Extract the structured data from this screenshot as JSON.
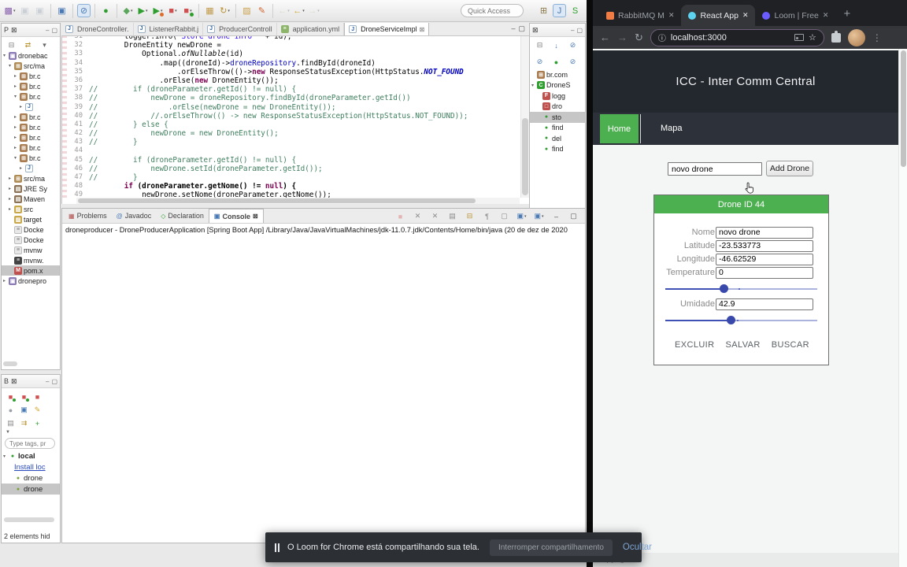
{
  "colors": {
    "accent_green": "#4caf50",
    "slider_blue": "#3f51b5",
    "page_header_bg": "#23272e",
    "nav_bg": "#2d323a",
    "chrome_dark": "#202124",
    "chrome_toolbar": "#35363a"
  },
  "eclipse": {
    "main_toolbar": {
      "quick_access_placeholder": "Quick Access",
      "icons": [
        {
          "name": "new-wizard-icon",
          "glyph": "▩",
          "color": "#8a62ad",
          "dd": true
        },
        {
          "name": "save-icon",
          "glyph": "▣",
          "color": "#8899aa",
          "disabled": true
        },
        {
          "name": "save-all-icon",
          "glyph": "▣",
          "color": "#8899aa",
          "disabled": true
        },
        {
          "sep": true
        },
        {
          "name": "console-view-icon",
          "glyph": "▣",
          "color": "#4a7ab5"
        },
        {
          "sep": true
        },
        {
          "name": "skip-breakpoints-icon",
          "glyph": "⊘",
          "color": "#4a7ab5",
          "pressed": true
        },
        {
          "sep": true
        },
        {
          "name": "boot-devtools-icon",
          "glyph": "●",
          "color": "#2f9e2f"
        },
        {
          "sep": true
        },
        {
          "name": "debug-icon",
          "glyph": "◆",
          "color": "#5aa65a",
          "dd": true
        },
        {
          "name": "run-icon",
          "glyph": "▶",
          "color": "#2f9e2f",
          "dd": true
        },
        {
          "name": "profile-icon",
          "glyph": "▶",
          "color": "#2f9e2f",
          "badge": "#e06c2c",
          "dd": true
        },
        {
          "name": "stop-icon",
          "glyph": "■",
          "color": "#d14f4f",
          "dd": true
        },
        {
          "name": "relaunch-icon",
          "glyph": "■",
          "color": "#d14f4f",
          "badge": "#2f9e2f",
          "dd": true
        },
        {
          "sep": true
        },
        {
          "name": "table-icon",
          "glyph": "▦",
          "color": "#c09a4a"
        },
        {
          "name": "update-project-icon",
          "glyph": "↻",
          "color": "#b8902c",
          "dd": true
        },
        {
          "sep": true
        },
        {
          "name": "open-resource-icon",
          "glyph": "▨",
          "color": "#caa24e"
        },
        {
          "name": "external-tools-icon",
          "glyph": "✎",
          "color": "#d1622c"
        },
        {
          "sep": true
        },
        {
          "name": "back-history-icon",
          "glyph": "←",
          "color": "#c0b090",
          "disabled": true,
          "dd": true
        },
        {
          "name": "back-icon",
          "glyph": "←",
          "color": "#d1a52c",
          "dd": true
        },
        {
          "name": "forward-icon",
          "glyph": "→",
          "color": "#c0b090",
          "disabled": true,
          "dd": true
        }
      ],
      "right_icons": [
        {
          "name": "open-perspective-icon",
          "glyph": "⊞",
          "color": "#8a7a4a"
        },
        {
          "name": "java-perspective-icon",
          "glyph": "J",
          "color": "#4a7ab5",
          "pressed": true
        },
        {
          "name": "spring-perspective-icon",
          "glyph": "S",
          "color": "#2f9e2f"
        }
      ]
    },
    "package_explorer": {
      "tab_label": "P",
      "tool_icons": [
        {
          "name": "collapse-all-icon",
          "glyph": "⊟",
          "color": "#777"
        },
        {
          "name": "link-editor-icon",
          "glyph": "⇄",
          "color": "#b8902c"
        },
        {
          "name": "view-menu-icon",
          "glyph": "▾",
          "color": "#666"
        }
      ],
      "items": [
        {
          "icon": "project-icon",
          "label": "dronebac",
          "exp": "open",
          "depth": 0
        },
        {
          "icon": "source-folder-icon",
          "label": "src/ma",
          "exp": "open",
          "depth": 1
        },
        {
          "icon": "package-icon",
          "label": "br.c",
          "exp": "closed",
          "depth": 2
        },
        {
          "icon": "package-icon",
          "label": "br.c",
          "exp": "closed",
          "depth": 2
        },
        {
          "icon": "package-icon",
          "label": "br.c",
          "exp": "open",
          "depth": 2
        },
        {
          "icon": "java-file-icon",
          "label": "",
          "exp": "closed",
          "depth": 3
        },
        {
          "icon": "package-icon",
          "label": "br.c",
          "exp": "closed",
          "depth": 2
        },
        {
          "icon": "package-icon",
          "label": "br.c",
          "exp": "closed",
          "depth": 2
        },
        {
          "icon": "package-icon",
          "label": "br.c",
          "exp": "closed",
          "depth": 2
        },
        {
          "icon": "package-icon",
          "label": "br.c",
          "exp": "closed",
          "depth": 2
        },
        {
          "icon": "package-icon",
          "label": "br.c",
          "exp": "open",
          "depth": 2
        },
        {
          "icon": "java-file-icon",
          "label": "",
          "exp": "closed",
          "depth": 3
        },
        {
          "icon": "source-folder-icon",
          "label": "src/ma",
          "exp": "closed",
          "depth": 1
        },
        {
          "icon": "library-icon",
          "label": "JRE Sy",
          "exp": "closed",
          "depth": 1
        },
        {
          "icon": "library-icon",
          "label": "Maven",
          "exp": "closed",
          "depth": 1
        },
        {
          "icon": "folder-icon",
          "label": "src",
          "exp": "closed",
          "depth": 1
        },
        {
          "icon": "folder-icon",
          "label": "target",
          "exp": null,
          "depth": 1
        },
        {
          "icon": "file-icon",
          "label": "Docke",
          "exp": null,
          "depth": 1
        },
        {
          "icon": "file-icon",
          "label": "Docke",
          "exp": null,
          "depth": 1
        },
        {
          "icon": "file-icon",
          "label": "mvnw",
          "exp": null,
          "depth": 1
        },
        {
          "icon": "dark-file-icon",
          "label": "mvnw.",
          "exp": null,
          "depth": 1
        },
        {
          "icon": "pom-icon",
          "label": "pom.x",
          "exp": null,
          "depth": 1,
          "selected": true
        },
        {
          "icon": "project-icon",
          "label": "dronepro",
          "exp": "closed",
          "depth": 0
        }
      ]
    },
    "editor": {
      "tabs": [
        {
          "icon": "java-file-icon",
          "label": "DroneController."
        },
        {
          "icon": "java-file-icon",
          "label": "ListenerRabbit.j"
        },
        {
          "icon": "java-file-icon",
          "label": "ProducerControll"
        },
        {
          "icon": "yaml-file-icon",
          "label": "application.yml"
        },
        {
          "icon": "java-file-icon",
          "label": "DroneServiceImpl",
          "active": true
        }
      ],
      "code_lines": [
        {
          "n": 31,
          "seg": [
            [
              "d",
              "        logger.info("
            ],
            [
              "str",
              "\"Store drone info \""
            ],
            [
              "d",
              " + id);"
            ]
          ]
        },
        {
          "n": 32,
          "seg": [
            [
              "d",
              "        DroneEntity newDrone ="
            ]
          ]
        },
        {
          "n": 33,
          "seg": [
            [
              "d",
              "            Optional."
            ],
            [
              "it",
              "ofNullable"
            ],
            [
              "d",
              "(id)"
            ]
          ]
        },
        {
          "n": 34,
          "seg": [
            [
              "d",
              "                .map((droneId)->"
            ],
            [
              "f",
              "droneRepository"
            ],
            [
              "d",
              ".findById(droneId)"
            ]
          ]
        },
        {
          "n": 35,
          "seg": [
            [
              "d",
              "                    .orElseThrow(()->"
            ],
            [
              "k",
              "new"
            ],
            [
              "d",
              " ResponseStatusException(HttpStatus."
            ],
            [
              "st",
              "NOT_FOUND"
            ]
          ]
        },
        {
          "n": 36,
          "seg": [
            [
              "d",
              "                .orElse("
            ],
            [
              "k",
              "new"
            ],
            [
              "d",
              " DroneEntity());"
            ]
          ]
        },
        {
          "n": 37,
          "seg": [
            [
              "c",
              "//        if (droneParameter.getId() != null) {"
            ]
          ]
        },
        {
          "n": 38,
          "seg": [
            [
              "c",
              "//            newDrone = droneRepository.findById(droneParameter.getId())"
            ]
          ]
        },
        {
          "n": 39,
          "seg": [
            [
              "c",
              "//                .orElse(newDrone = new DroneEntity());"
            ]
          ]
        },
        {
          "n": 40,
          "seg": [
            [
              "c",
              "//            //.orElseThrow(() -> new ResponseStatusException(HttpStatus.NOT_FOUND));"
            ]
          ]
        },
        {
          "n": 41,
          "seg": [
            [
              "c",
              "//        } else {"
            ]
          ]
        },
        {
          "n": 42,
          "seg": [
            [
              "c",
              "//            newDrone = new DroneEntity();"
            ]
          ]
        },
        {
          "n": 43,
          "seg": [
            [
              "c",
              "//        }"
            ]
          ]
        },
        {
          "n": 44,
          "seg": []
        },
        {
          "n": 45,
          "seg": [
            [
              "c",
              "//        if (droneParameter.getId() != null) {"
            ]
          ]
        },
        {
          "n": 46,
          "seg": [
            [
              "c",
              "//            newDrone.setId(droneParameter.getId());"
            ]
          ]
        },
        {
          "n": 47,
          "seg": [
            [
              "c",
              "//        }"
            ]
          ]
        },
        {
          "n": 48,
          "bold": true,
          "seg": [
            [
              "d",
              "        "
            ],
            [
              "k",
              "if"
            ],
            [
              "d",
              " (droneParameter.getNome() != "
            ],
            [
              "k",
              "null"
            ],
            [
              "d",
              ") {"
            ]
          ]
        },
        {
          "n": 49,
          "seg": [
            [
              "d",
              "            newDrone.setNome(droneParameter.getNome());"
            ]
          ]
        }
      ]
    },
    "outline": {
      "tool_icons": [
        {
          "name": "collapse-all-icon",
          "glyph": "⊟",
          "color": "#777"
        },
        {
          "name": "sort-icon",
          "glyph": "↓",
          "color": "#4a7ab5"
        },
        {
          "name": "hide-fields-icon",
          "glyph": "⊘",
          "color": "#4a7ab5"
        },
        {
          "name": "hide-static-icon",
          "glyph": "⊘",
          "color": "#4a7ab5"
        },
        {
          "name": "hide-nonpublic-icon",
          "glyph": "●",
          "color": "#2f9e2f"
        },
        {
          "name": "hide-local-icon",
          "glyph": "⊘",
          "color": "#4a7ab5"
        }
      ],
      "items": [
        {
          "icon": "package-grid-icon",
          "label": "br.com",
          "exp": null,
          "depth": 0
        },
        {
          "icon": "class-icon",
          "label": "DroneS",
          "exp": "open",
          "depth": 0
        },
        {
          "icon": "field-final-icon",
          "label": "logg",
          "exp": null,
          "depth": 1
        },
        {
          "icon": "field-icon",
          "label": "dro",
          "exp": null,
          "depth": 1
        },
        {
          "icon": "method-icon",
          "label": "sto",
          "exp": null,
          "depth": 1,
          "selected": true
        },
        {
          "icon": "method-icon",
          "label": "find",
          "exp": null,
          "depth": 1
        },
        {
          "icon": "method-icon",
          "label": "del",
          "exp": null,
          "depth": 1
        },
        {
          "icon": "method-icon",
          "label": "find",
          "exp": null,
          "depth": 1
        }
      ]
    },
    "console": {
      "tabs": [
        {
          "name": "tab-problems",
          "icon_glyph": "▦",
          "icon_color": "#b05050",
          "label": "Problems"
        },
        {
          "name": "tab-javadoc",
          "icon_glyph": "@",
          "icon_color": "#4a7ab5",
          "label": "Javadoc"
        },
        {
          "name": "tab-declaration",
          "icon_glyph": "◇",
          "icon_color": "#2f9e2f",
          "label": "Declaration"
        },
        {
          "name": "tab-console",
          "icon_glyph": "▣",
          "icon_color": "#4a7ab5",
          "label": "Console",
          "active": true,
          "close": true
        }
      ],
      "right_icons": [
        {
          "name": "terminate-icon",
          "glyph": "■",
          "color": "#d14f4f",
          "disabled": true
        },
        {
          "name": "remove-launch-icon",
          "glyph": "✕",
          "color": "#8a8a8a"
        },
        {
          "name": "remove-all-icon",
          "glyph": "✕",
          "color": "#8a8a8a"
        },
        {
          "name": "clear-console-icon",
          "glyph": "▤",
          "color": "#8a8a8a"
        },
        {
          "name": "scroll-lock-icon",
          "glyph": "⊟",
          "color": "#b8902c"
        },
        {
          "name": "word-wrap-icon",
          "glyph": "¶",
          "color": "#8a8a8a"
        },
        {
          "name": "pin-console-icon",
          "glyph": "▢",
          "color": "#8a8a8a"
        },
        {
          "name": "display-console-icon",
          "glyph": "▣",
          "color": "#4a7ab5",
          "dd": true
        },
        {
          "name": "open-console-icon",
          "glyph": "▣",
          "color": "#4a7ab5",
          "dd": true
        },
        {
          "name": "minimize-icon",
          "glyph": "‒",
          "color": "#555"
        },
        {
          "name": "maximize-icon",
          "glyph": "▢",
          "color": "#555"
        }
      ],
      "text": "droneproducer - DroneProducerApplication [Spring Boot App] /Library/Java/JavaVirtualMachines/jdk-11.0.7.jdk/Contents/Home/bin/java (20 de dez de 2020"
    },
    "boot_dashboard": {
      "tab_label": "B",
      "icons": [
        {
          "name": "restart-icon",
          "glyph": "■",
          "color": "#d14f4f",
          "badge": "#2f9e2f"
        },
        {
          "name": "start-icon",
          "glyph": "■",
          "color": "#d14f4f",
          "badge": "#2f9e2f"
        },
        {
          "name": "stop-icon",
          "glyph": "■",
          "color": "#d14f4f"
        },
        {
          "name": "open-web-icon",
          "glyph": "●",
          "color": "#9aa0a6"
        },
        {
          "name": "open-console-icon",
          "glyph": "▣",
          "color": "#4a7ab5"
        },
        {
          "name": "edit-config-icon",
          "glyph": "✎",
          "color": "#d1a52c"
        },
        {
          "name": "list-icon",
          "glyph": "▤",
          "color": "#8a8a8a"
        },
        {
          "name": "redeploy-icon",
          "glyph": "⇉",
          "color": "#b8902c"
        },
        {
          "name": "add-target-icon",
          "glyph": "+",
          "color": "#2f9e2f"
        }
      ],
      "filter_placeholder": "Type tags, pr",
      "items": [
        {
          "icon": "boot-local-icon",
          "label": "local",
          "exp": "open",
          "depth": 0,
          "bold": true
        },
        {
          "icon": null,
          "label": "Install loc",
          "exp": null,
          "depth": 1,
          "link": true
        },
        {
          "icon": "bug-icon",
          "label": "drone",
          "exp": null,
          "depth": 1
        },
        {
          "icon": "bug-icon",
          "label": "drone",
          "exp": null,
          "depth": 1,
          "selected": true
        }
      ],
      "note": "2 elements hid"
    }
  },
  "browser": {
    "tabs": [
      {
        "name": "tab-rabbitmq",
        "favicon": "rabbitmq-icon",
        "label": "RabbitMQ M",
        "close": "✕"
      },
      {
        "name": "tab-react-app",
        "favicon": "react-icon",
        "label": "React App",
        "close": "✕",
        "active": true
      },
      {
        "name": "tab-loom",
        "favicon": "loom-icon",
        "label": "Loom | Free",
        "close": "✕"
      }
    ],
    "new_tab_label": "+",
    "url": "localhost:3000",
    "page": {
      "title": "ICC - Inter Comm Central",
      "nav": [
        "Home",
        "Mapa"
      ],
      "add_form": {
        "input_value": "novo drone",
        "button_label": "Add Drone"
      },
      "drone_card": {
        "header": "Drone ID 44",
        "rows": [
          {
            "type": "field",
            "name": "nome-field",
            "label": "Nome",
            "value": "novo drone"
          },
          {
            "type": "field",
            "name": "latitude-field",
            "label": "Latitude",
            "value": "-23.533773"
          },
          {
            "type": "field",
            "name": "longitude-field",
            "label": "Longitude",
            "value": "-46.62529"
          },
          {
            "type": "field",
            "name": "temperature-field",
            "label": "Temperature",
            "value": "0"
          },
          {
            "type": "slider",
            "name": "temperature-slider",
            "percent": 38.5,
            "mark": 48
          },
          {
            "type": "field",
            "name": "umidade-field",
            "label": "Umidade",
            "value": "42.9"
          },
          {
            "type": "slider",
            "name": "humidity-slider",
            "percent": 43,
            "mark": 47
          }
        ],
        "buttons": [
          "EXCLUIR",
          "SALVAR",
          "BUSCAR"
        ]
      },
      "footer": "Copyright ©"
    }
  },
  "loom": {
    "message": "O Loom for Chrome está compartilhando sua tela.",
    "stop_button": "Interromper compartilhamento",
    "hide_button": "Ocultar"
  }
}
